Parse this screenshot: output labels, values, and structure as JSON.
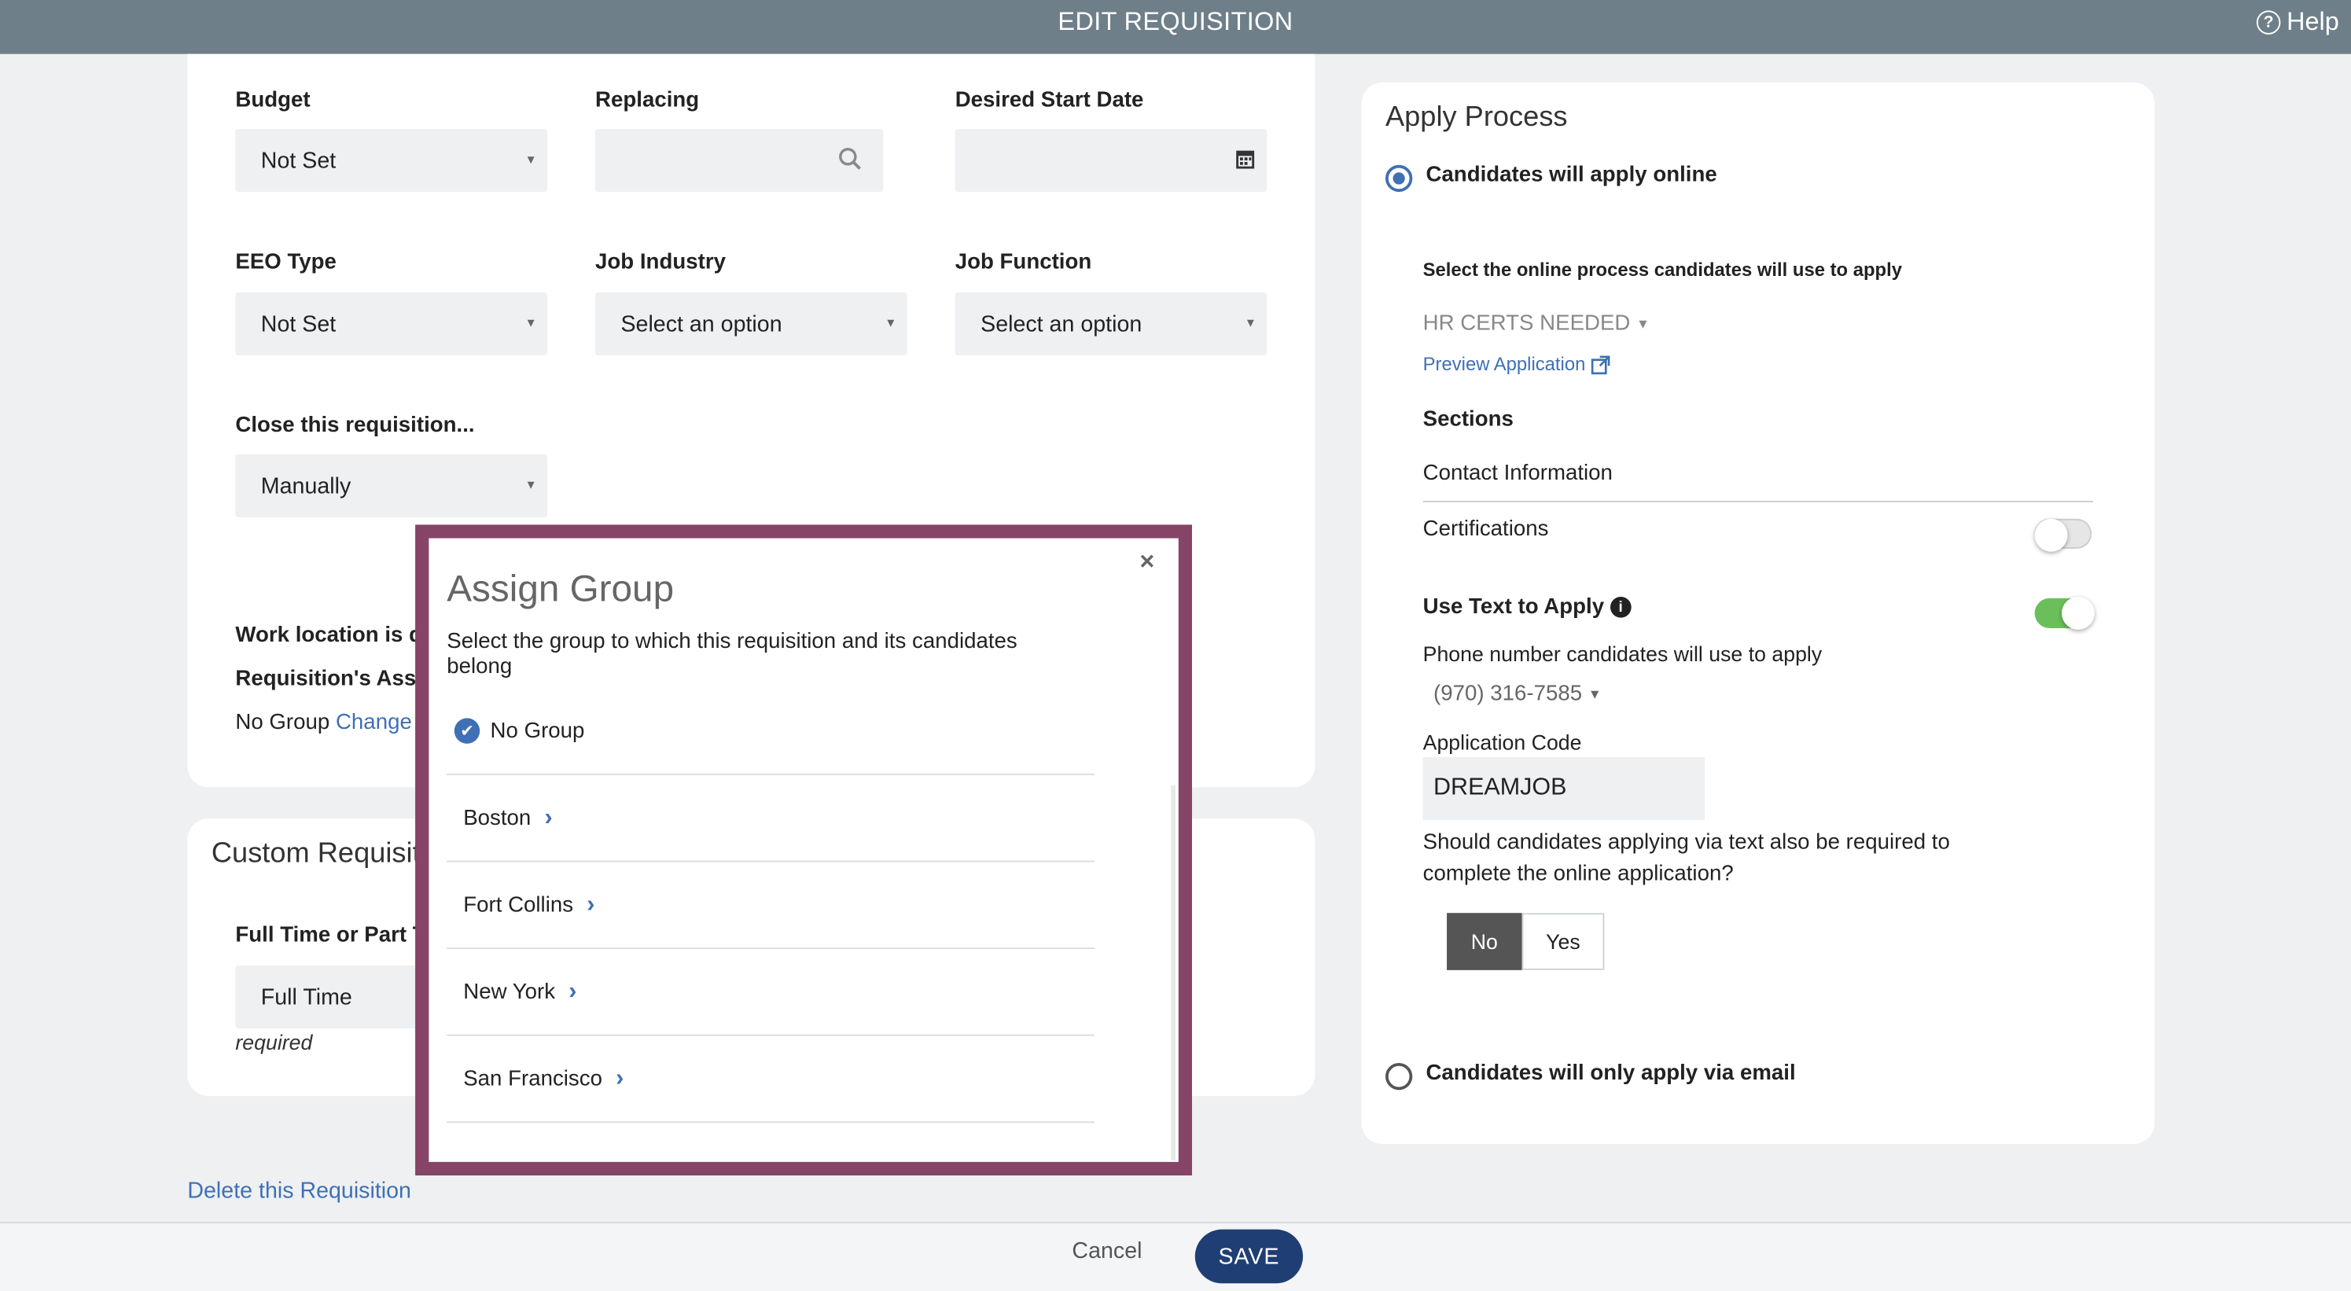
{
  "header": {
    "title": "EDIT REQUISITION",
    "help": "Help"
  },
  "form": {
    "budget": {
      "label": "Budget",
      "value": "Not Set"
    },
    "replacing": {
      "label": "Replacing",
      "value": ""
    },
    "start_date": {
      "label": "Desired Start Date",
      "value": ""
    },
    "eeo": {
      "label": "EEO Type",
      "value": "Not Set"
    },
    "industry": {
      "label": "Job Industry",
      "value": "Select an option"
    },
    "function": {
      "label": "Job Function",
      "value": "Select an option"
    },
    "close": {
      "label": "Close this requisition...",
      "value": "Manually"
    },
    "work_location": "Work location is di",
    "req_assign": "Requisition's Assig",
    "group_value": "No Group",
    "group_change": "Change"
  },
  "custom": {
    "title": "Custom Requisit",
    "field_label": "Full Time or Part T",
    "field_value": "Full Time",
    "required": "required"
  },
  "delete_link": "Delete this Requisition",
  "footer": {
    "cancel": "Cancel",
    "save": "SAVE"
  },
  "modal": {
    "title": "Assign Group",
    "close": "×",
    "description": "Select the group to which this requisition and its candidates belong",
    "selected": "No Group",
    "groups": [
      "Boston",
      "Fort Collins",
      "New York",
      "San Francisco"
    ]
  },
  "apply": {
    "title": "Apply Process",
    "online_label": "Candidates will apply online",
    "online_selected": true,
    "process_label": "Select the online process candidates will use to apply",
    "process_value": "HR CERTS NEEDED",
    "preview": "Preview Application",
    "sections_label": "Sections",
    "sections": [
      {
        "name": "Contact Information"
      },
      {
        "name": "Certifications",
        "enabled": false
      }
    ],
    "text_apply": {
      "label": "Use Text to Apply",
      "enabled": true
    },
    "phone_label": "Phone number candidates will use to apply",
    "phone_value": "(970) 316-7585",
    "code_label": "Application Code",
    "code_value": "DREAMJOB",
    "question": "Should candidates applying via text also be required to complete the online application?",
    "options": [
      "No",
      "Yes"
    ],
    "selected_option": "No",
    "email_label": "Candidates will only apply via email",
    "email_selected": false
  },
  "colors": {
    "header": "#6f7f89",
    "accent": "#3f70b5",
    "modal_border": "#864467",
    "save": "#1f3e73",
    "toggle_on": "#6bbf5a"
  }
}
